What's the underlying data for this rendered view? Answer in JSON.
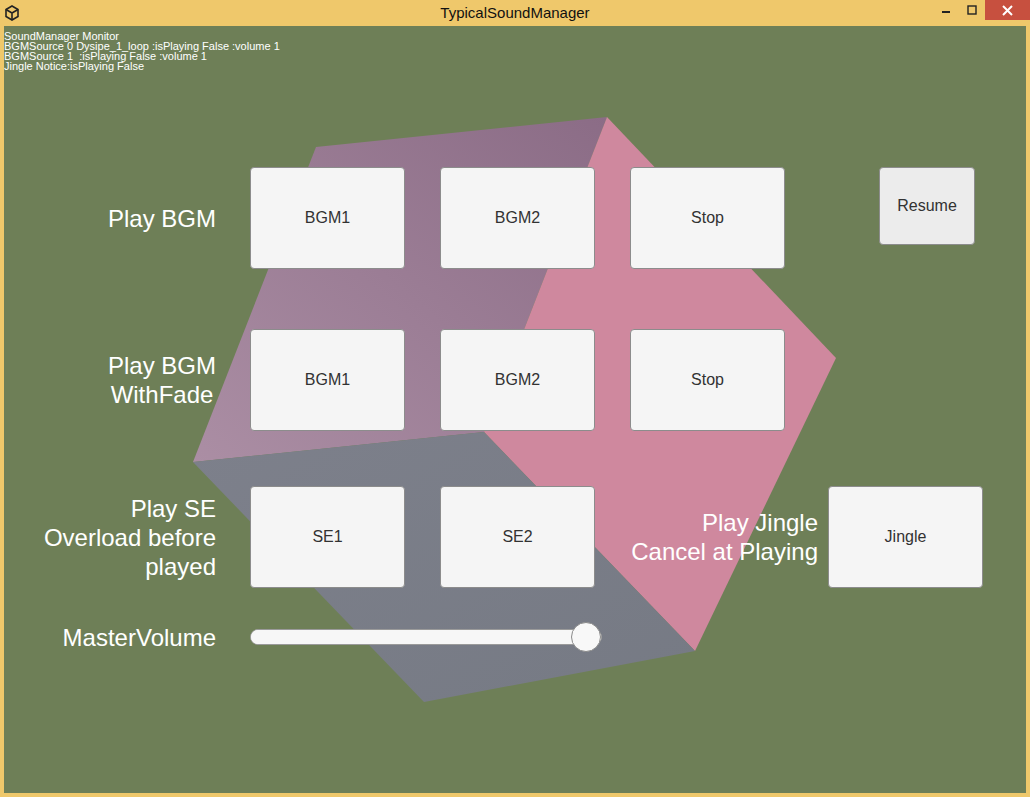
{
  "window": {
    "title": "TypicalSoundManager"
  },
  "monitor": [
    "SoundManager Monitor",
    "BGMSource 0 Dysipe_1_loop :isPlaying False :volume 1",
    "BGMSource 1  :isPlaying False :volume 1",
    "Jingle Notice:isPlaying False"
  ],
  "rows": [
    {
      "label": [
        "Play BGM"
      ],
      "buttons": [
        "BGM1",
        "BGM2",
        "Stop"
      ]
    },
    {
      "label": [
        "Play BGM",
        "WithFade"
      ],
      "buttons": [
        "BGM1",
        "BGM2",
        "Stop"
      ]
    },
    {
      "label": [
        "Play SE",
        "Overload before",
        "played"
      ],
      "buttons": [
        "SE1",
        "SE2"
      ]
    }
  ],
  "resume": "Resume",
  "jingle": {
    "label": [
      "Play Jingle",
      "Cancel at Playing"
    ],
    "button": "Jingle"
  },
  "master_volume": {
    "label": "MasterVolume",
    "level": 1
  }
}
